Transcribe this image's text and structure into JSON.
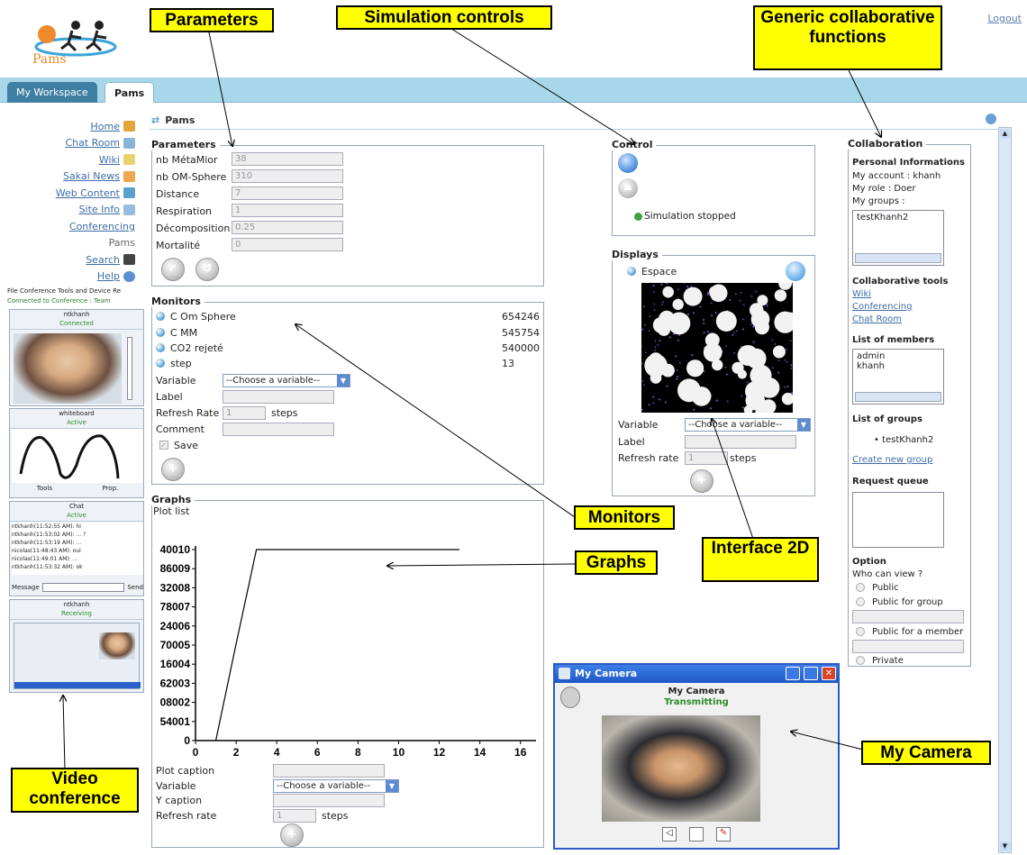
{
  "header": {
    "logo_text": "Pams",
    "logout": "Logout"
  },
  "tabs": [
    {
      "label": "My Workspace"
    },
    {
      "label": "Pams"
    }
  ],
  "nav": {
    "items": [
      {
        "label": "Home",
        "icon": "home-icon"
      },
      {
        "label": "Chat Room",
        "icon": "chat-icon"
      },
      {
        "label": "Wiki",
        "icon": "wiki-icon"
      },
      {
        "label": "Sakai News",
        "icon": "news-icon"
      },
      {
        "label": "Web Content",
        "icon": "web-icon"
      },
      {
        "label": "Site Info",
        "icon": "siteinfo-icon"
      },
      {
        "label": "Conferencing",
        "icon": ""
      },
      {
        "label": "Pams",
        "icon": ""
      },
      {
        "label": "Search",
        "icon": "search-icon"
      },
      {
        "label": "Help",
        "icon": "help-icon"
      }
    ]
  },
  "videoconf": {
    "menu": "File  Conference  Tools  and  Device  Re",
    "status": "Connected to Conference : Team",
    "panel1": {
      "user": "ntkhanh",
      "state": "Connected"
    },
    "panel2": {
      "user": "whiteboard",
      "state": "Active",
      "tools": "Tools",
      "prop": "Prop."
    },
    "panel3": {
      "user": "Chat",
      "state": "Active",
      "lines": [
        "ntkhanh(11:52:55 AM): hi",
        "ntkhanh(11:53:02 AM): ... ?",
        "ntkhanh(11:53:19 AM): ...",
        "nicolas(11:48:43 AM): oui",
        "nicolas(11:49:01 AM): ...",
        "ntkhanh(11:53:32 AM): ok"
      ],
      "message_label": "Message",
      "send": "Send"
    },
    "panel4": {
      "user": "ntkhanh",
      "state": "Receiving"
    }
  },
  "page": {
    "title": "Pams"
  },
  "parameters": {
    "legend": "Parameters",
    "fields": [
      {
        "label": "nb MétaMior",
        "value": "38"
      },
      {
        "label": "nb OM-Sphere",
        "value": "310"
      },
      {
        "label": "Distance",
        "value": "7"
      },
      {
        "label": "Respiration",
        "value": "1"
      },
      {
        "label": "Décomposition",
        "value": "0.25"
      },
      {
        "label": "Mortalité",
        "value": "0"
      }
    ]
  },
  "monitors": {
    "legend": "Monitors",
    "rows": [
      {
        "label": "C Om Sphere",
        "value": "654246"
      },
      {
        "label": "C MM",
        "value": "545754"
      },
      {
        "label": "CO2 rejeté",
        "value": "540000"
      },
      {
        "label": "step",
        "value": "13"
      }
    ],
    "variable_label": "Variable",
    "variable_value": "--Choose a variable--",
    "label_label": "Label",
    "refresh_label": "Refresh Rate",
    "refresh_value": "1",
    "refresh_unit": "steps",
    "comment_label": "Comment",
    "save_label": "Save"
  },
  "graphs": {
    "legend": "Graphs",
    "plot_list": "Plot list",
    "plot_caption_label": "Plot caption",
    "variable_label": "Variable",
    "variable_value": "--Choose a variable--",
    "ycaption_label": "Y caption",
    "refresh_label": "Refresh rate",
    "refresh_value": "1",
    "refresh_unit": "steps"
  },
  "chart_data": {
    "type": "line",
    "x": [
      1,
      2,
      3,
      13
    ],
    "y": [
      0,
      324012,
      640010,
      640010
    ],
    "ytick_labels": [
      "0",
      "54001",
      "08002",
      "62003",
      "16004",
      "70005",
      "24006",
      "78007",
      "32008",
      "86009",
      "40010"
    ],
    "xticks": [
      0,
      2,
      4,
      6,
      8,
      10,
      12,
      14,
      16
    ],
    "xlim": [
      0,
      16.5
    ],
    "ylim": [
      0,
      640010
    ]
  },
  "control": {
    "legend": "Control",
    "status": "Simulation stopped"
  },
  "displays": {
    "legend": "Displays",
    "espace": "Espace",
    "variable_label": "Variable",
    "variable_value": "--Choose a variable--",
    "label_label": "Label",
    "refresh_label": "Refresh rate",
    "refresh_value": "1",
    "refresh_unit": "steps"
  },
  "collaboration": {
    "legend": "Collaboration",
    "personal_title": "Personal Informations",
    "account": "My account  :   khanh",
    "role": "My role : Doer",
    "groups_label": "My groups  :",
    "groups": [
      "testKhanh2"
    ],
    "tools_title": "Collaborative tools",
    "tools": [
      "Wiki",
      "Conferencing",
      "Chat Room"
    ],
    "members_title": "List of members",
    "members": [
      "admin",
      "khanh"
    ],
    "groups_title": "List of groups",
    "group_list": [
      "testKhanh2"
    ],
    "create_group": "Create new group",
    "request_title": "Request queue",
    "option_title": "Option",
    "who_can_view": "Who can view ?",
    "options": [
      "Public",
      "Public for group",
      "Public for a member",
      "Private"
    ]
  },
  "camera": {
    "title": "My Camera",
    "name": "My Camera",
    "state": "Transmitting"
  },
  "callouts": {
    "parameters": "Parameters",
    "simulation_controls": "Simulation controls",
    "generic_collab": "Generic collaborative functions",
    "monitors": "Monitors",
    "graphs": "Graphs",
    "interface2d": "Interface 2D",
    "my_camera": "My Camera",
    "video_conf": "Video conference"
  }
}
